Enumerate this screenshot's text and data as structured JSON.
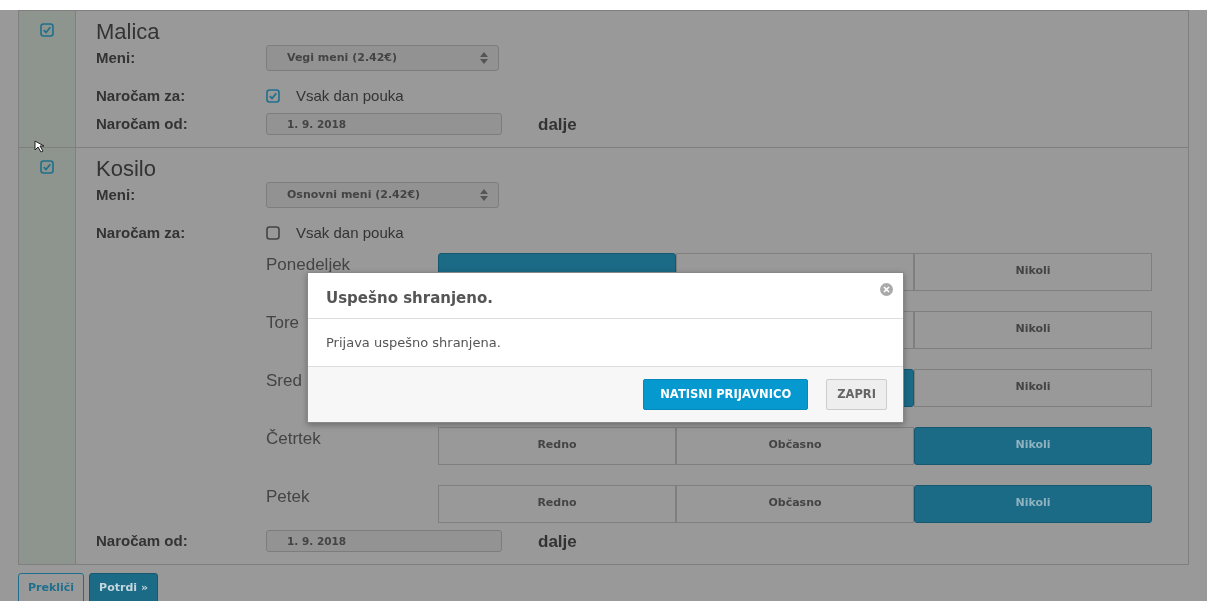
{
  "sections": [
    {
      "checked": true,
      "title": "Malica",
      "menu_label": "Meni:",
      "menu_value": "Vegi meni (2.42€)",
      "order_for_label": "Naročam za:",
      "every_day": {
        "label": "Vsak dan pouka",
        "checked": true
      },
      "order_from_label": "Naročam od:",
      "order_from_value": "1. 9. 2018",
      "order_from_suffix": "dalje"
    },
    {
      "checked": true,
      "title": "Kosilo",
      "menu_label": "Meni:",
      "menu_value": "Osnovni meni (2.42€)",
      "order_for_label": "Naročam za:",
      "every_day": {
        "label": "Vsak dan pouka",
        "checked": false
      },
      "days": [
        {
          "label": "Ponedeljek",
          "options": [
            {
              "selected": true
            },
            {
              "selected": false
            },
            {
              "label": "Nikoli",
              "selected": false
            }
          ]
        },
        {
          "label": "Tore",
          "options": [
            {
              "selected": false
            },
            {
              "label": "Nikoli",
              "selected": false
            }
          ]
        },
        {
          "label": "Sred",
          "options": [
            {
              "selected": true
            },
            {
              "label": "Nikoli",
              "selected": false
            }
          ]
        },
        {
          "label": "Četrtek",
          "options": [
            {
              "label": "Redno",
              "selected": false
            },
            {
              "label": "Občasno",
              "selected": false
            },
            {
              "label": "Nikoli",
              "selected": true
            }
          ]
        },
        {
          "label": "Petek",
          "options": [
            {
              "label": "Redno",
              "selected": false
            },
            {
              "label": "Občasno",
              "selected": false
            },
            {
              "label": "Nikoli",
              "selected": true
            }
          ]
        }
      ],
      "order_from_label": "Naročam od:",
      "order_from_value": "1. 9. 2018",
      "order_from_suffix": "dalje"
    }
  ],
  "buttons": [
    {
      "label": "Prekliči",
      "kind": "outline"
    },
    {
      "label": "Potrdi »",
      "kind": "primary"
    }
  ],
  "dialog": {
    "title": "Uspešno shranjeno.",
    "message": "Prijava uspešno shranjena.",
    "buttons": [
      {
        "label": "NATISNI PRIJAVNICO",
        "kind": "primary"
      },
      {
        "label": "ZAPRI",
        "kind": "secondary"
      }
    ]
  }
}
